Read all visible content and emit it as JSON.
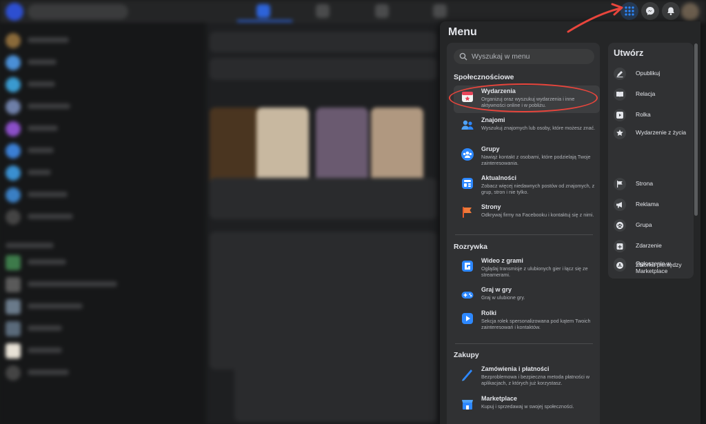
{
  "menu": {
    "title": "Menu",
    "search_placeholder": "Wyszukaj w menu",
    "sections": [
      {
        "heading": "Społecznościowe",
        "items": [
          {
            "title": "Wydarzenia",
            "desc": "Organizuj oraz wyszukuj wydarzenia i inne aktywności online i w pobliżu."
          },
          {
            "title": "Znajomi",
            "desc": "Wyszukuj znajomych lub osoby, które możesz znać."
          },
          {
            "title": "Grupy",
            "desc": "Nawiąż kontakt z osobami, które podzielają Twoje zainteresowania."
          },
          {
            "title": "Aktualności",
            "desc": "Zobacz więcej niedawnych postów od znajomych, z grup, stron i nie tylko."
          },
          {
            "title": "Strony",
            "desc": "Odkrywaj firmy na Facebooku i kontaktuj się z nimi."
          }
        ]
      },
      {
        "heading": "Rozrywka",
        "items": [
          {
            "title": "Wideo z grami",
            "desc": "Oglądaj transmisje z ulubionych gier i łącz się ze streamerami."
          },
          {
            "title": "Graj w gry",
            "desc": "Graj w ulubione gry."
          },
          {
            "title": "Rolki",
            "desc": "Sekcja rolek spersonalizowana pod kątem Twoich zainteresowań i kontaktów."
          }
        ]
      },
      {
        "heading": "Zakupy",
        "items": [
          {
            "title": "Zamówienia i płatności",
            "desc": "Bezproblemowa i bezpieczna metoda płatności w aplikacjach, z których już korzystasz."
          },
          {
            "title": "Marketplace",
            "desc": "Kupuj i sprzedawaj w swojej społeczności."
          }
        ]
      }
    ]
  },
  "create": {
    "title": "Utwórz",
    "items": [
      "Opublikuj",
      "Relacja",
      "Rolka",
      "Wydarzenie z życia",
      "Strona",
      "Reklama",
      "Grupa",
      "Zdarzenie",
      "Ogłoszenie w Marketplace",
      "Zbiórka pieniędzy"
    ]
  },
  "colors": {
    "accent": "#2d88ff",
    "annotation": "#e8453c",
    "panel": "#252627",
    "card": "#303133"
  },
  "icons": {
    "topbar": [
      "menu-grid-icon",
      "messenger-icon",
      "bell-icon"
    ]
  }
}
